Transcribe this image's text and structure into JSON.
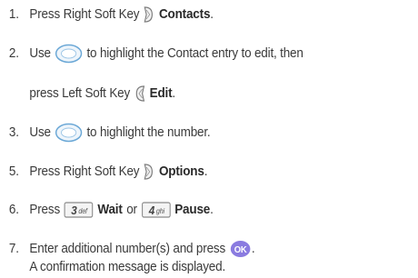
{
  "steps": [
    {
      "num": "1.",
      "pre": "Press Right Soft Key",
      "bold": "Contacts",
      "post": "."
    },
    {
      "num": "2.",
      "pre": "Use",
      "mid": "to highlight the Contact entry to edit, then"
    },
    {
      "cont": "press Left Soft Key",
      "bold": "Edit",
      "post": "."
    },
    {
      "num": "3.",
      "pre": "Use",
      "mid": "to highlight the number."
    },
    {
      "num": "5.",
      "pre": "Press Right Soft Key",
      "bold": "Options",
      "post": "."
    },
    {
      "num": "6.",
      "pre": "Press",
      "key1": "3",
      "key1sub": "def",
      "bold1": "Wait",
      "or": "or",
      "key2": "4",
      "key2sub": "ghi",
      "bold2": "Pause",
      "post": "."
    },
    {
      "num": "7.",
      "pre": "Enter additional number(s) and press",
      "ok": "OK",
      "post": "."
    },
    {
      "cont": "A confirmation message is displayed."
    }
  ],
  "icons": {
    "right_soft_key": "right-soft-key-icon",
    "left_soft_key": "left-soft-key-icon",
    "nav_key": "navigation-key-icon",
    "ok_key": "ok-key-icon"
  },
  "colors": {
    "text": "#3a3a3a",
    "ok_key": "#8a7be0",
    "nav_key": "#6aa7d6"
  }
}
